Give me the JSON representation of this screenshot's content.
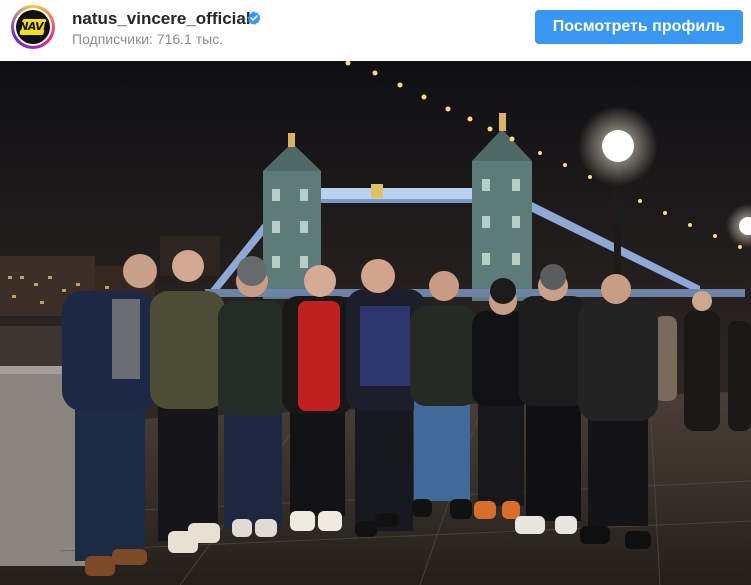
{
  "profile": {
    "username": "natus_vincere_official",
    "logo_text": "NAVI",
    "followers_label": "Подписчики: 716.1 тыс.",
    "verified_icon": "verified-badge-icon"
  },
  "actions": {
    "view_profile_label": "Посмотреть профиль"
  },
  "colors": {
    "button_bg": "#3897f0",
    "verified_blue": "#3897f0",
    "username": "#262626",
    "secondary_text": "#8e8e8e",
    "logo_yellow": "#f4df18"
  },
  "photo": {
    "subject": "group-of-nine-people-by-tower-bridge-at-night"
  }
}
